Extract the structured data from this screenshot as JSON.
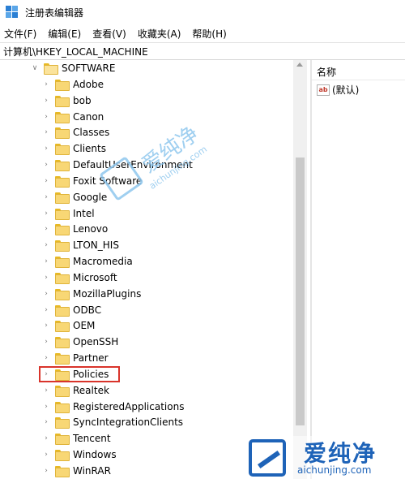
{
  "window": {
    "title": "注册表编辑器"
  },
  "menu": [
    "文件(F)",
    "编辑(E)",
    "查看(V)",
    "收藏夹(A)",
    "帮助(H)"
  ],
  "address": "计算机\\HKEY_LOCAL_MACHINE",
  "tree": {
    "parent": "SOFTWARE",
    "children": [
      "Adobe",
      "bob",
      "Canon",
      "Classes",
      "Clients",
      "DefaultUserEnvironment",
      "Foxit Software",
      "Google",
      "Intel",
      "Lenovo",
      "LTON_HIS",
      "Macromedia",
      "Microsoft",
      "MozillaPlugins",
      "ODBC",
      "OEM",
      "OpenSSH",
      "Partner",
      "Policies",
      "Realtek",
      "RegisteredApplications",
      "SyncIntegrationClients",
      "Tencent",
      "Windows",
      "WinRAR"
    ],
    "highlighted": "Policies"
  },
  "values_pane": {
    "column_header": "名称",
    "rows": [
      {
        "icon": "ab",
        "name": "(默认)"
      }
    ]
  },
  "watermark": {
    "cn": "爱纯净",
    "en": "aichunjing.com"
  },
  "colors": {
    "highlight": "#d9342b",
    "folder": "#f8d775",
    "watermark_blue": "#1e63b8"
  }
}
